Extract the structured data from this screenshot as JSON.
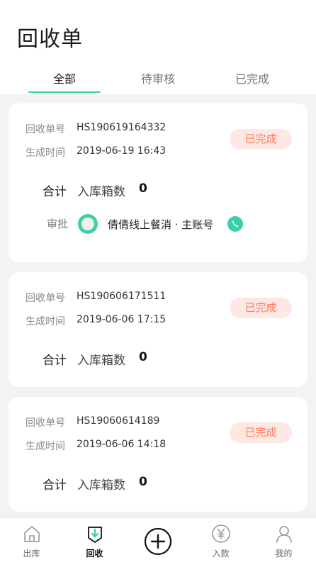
{
  "header": {
    "title": "回收单"
  },
  "tabs": [
    {
      "label": "全部",
      "active": true
    },
    {
      "label": "待审核",
      "active": false
    },
    {
      "label": "已完成",
      "active": false
    }
  ],
  "orders": [
    {
      "order_no_label": "回收单号",
      "order_no": "HS190619164332",
      "created_label": "生成时间",
      "created": "2019-06-19 16:43",
      "status": "已完成",
      "total_label": "合计",
      "total_sub": "入库箱数",
      "total_value": "0",
      "approval_label": "审批",
      "approver": "倩倩线上餐消 · 主账号"
    },
    {
      "order_no_label": "回收单号",
      "order_no": "HS190606171511",
      "created_label": "生成时间",
      "created": "2019-06-06 17:15",
      "status": "已完成",
      "total_label": "合计",
      "total_sub": "入库箱数",
      "total_value": "0"
    },
    {
      "order_no_label": "回收单号",
      "order_no": "HS19060614189",
      "created_label": "生成时间",
      "created": "2019-06-06 14:18",
      "status": "已完成",
      "total_label": "合计",
      "total_sub": "入库箱数",
      "total_value": "0"
    }
  ],
  "tabbar": [
    {
      "label": "出库",
      "icon": "home-icon"
    },
    {
      "label": "回收",
      "icon": "recycle-icon",
      "active": true
    },
    {
      "label": "",
      "icon": "plus-circle-icon"
    },
    {
      "label": "入款",
      "icon": "yen-icon"
    },
    {
      "label": "我的",
      "icon": "user-icon"
    }
  ],
  "colors": {
    "accent": "#3ccfa8",
    "status_text": "#ff7a5c",
    "status_bg": "#fde8e4"
  }
}
